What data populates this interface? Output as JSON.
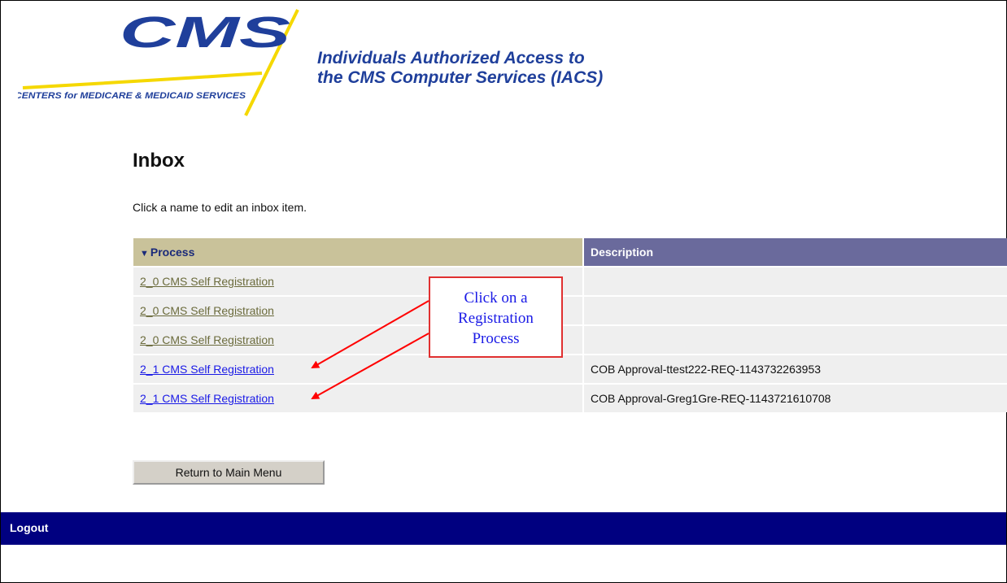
{
  "header": {
    "logo_text": "CMS",
    "logo_tagline": "CENTERS for MEDICARE & MEDICAID SERVICES",
    "title_line1": "Individuals Authorized Access to",
    "title_line2": "the CMS Computer Services (IACS)"
  },
  "page": {
    "title": "Inbox",
    "instruction": "Click a name to edit an inbox item."
  },
  "table": {
    "columns": {
      "process": "Process",
      "description": "Description"
    },
    "rows": [
      {
        "process": "2_0 CMS Self Registration",
        "description": ""
      },
      {
        "process": "2_0 CMS Self Registration",
        "description": ""
      },
      {
        "process": "2_0 CMS Self Registration",
        "description": ""
      },
      {
        "process": "2_1 CMS Self Registration",
        "description": "COB Approval-ttest222-REQ-1143732263953"
      },
      {
        "process": "2_1 CMS Self Registration",
        "description": "COB Approval-Greg1Gre-REQ-1143721610708"
      }
    ]
  },
  "callout": {
    "line1": "Click on a",
    "line2": "Registration",
    "line3": "Process"
  },
  "buttons": {
    "return_main": "Return to Main Menu"
  },
  "footer": {
    "logout": "Logout"
  },
  "colors": {
    "logo_blue": "#1f3f9b",
    "logo_yellow": "#f5d800",
    "process_header": "#c9c29a",
    "description_header": "#6a6a9c",
    "logout_bar": "#000080",
    "callout_border": "#e03030"
  }
}
